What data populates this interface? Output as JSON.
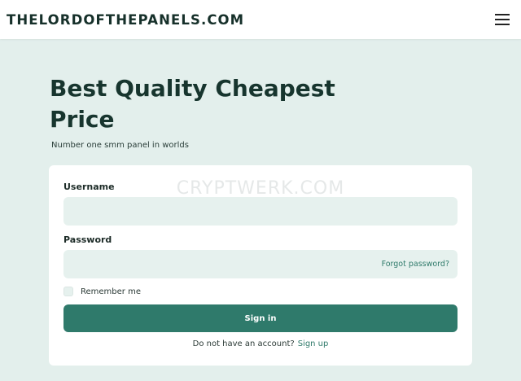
{
  "header": {
    "brand": "THELORDOFTHEPANELS.COM",
    "menu_icon": "hamburger-menu-icon"
  },
  "hero": {
    "title": "Best Quality Cheapest Price",
    "subtitle": "Number one smm panel in worlds"
  },
  "watermark": "CRYPTWERK.COM",
  "login": {
    "username_label": "Username",
    "username_value": "",
    "password_label": "Password",
    "password_value": "",
    "forgot_label": "Forgot password?",
    "remember_label": "Remember me",
    "remember_checked": false,
    "signin_label": "Sign in",
    "no_account_text": "Do not have an account?",
    "signup_label": "Sign up"
  },
  "colors": {
    "page_bg": "#e3efec",
    "accent": "#2f7a6b",
    "input_bg": "#e6f1ee",
    "title_text": "#17352e"
  }
}
